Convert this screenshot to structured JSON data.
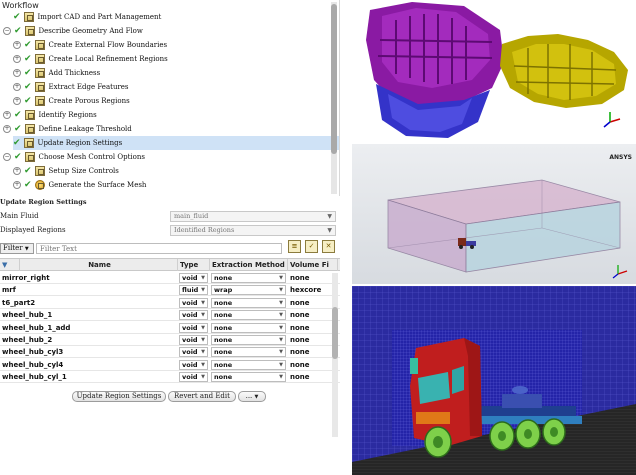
{
  "workflow": {
    "title": "Workflow",
    "items": [
      {
        "label": "Import CAD and Part Management",
        "expand": "",
        "icon": "import-cad-icon"
      },
      {
        "label": "Describe Geometry And Flow",
        "expand": "-",
        "icon": "geometry-icon"
      },
      {
        "label": "Create External Flow Boundaries",
        "expand": "+",
        "icon": "boundaries-icon"
      },
      {
        "label": "Create Local Refinement Regions",
        "expand": "+",
        "icon": "refinement-icon"
      },
      {
        "label": "Add Thickness",
        "expand": "+",
        "icon": "thickness-icon"
      },
      {
        "label": "Extract Edge Features",
        "expand": "+",
        "icon": "edge-features-icon"
      },
      {
        "label": "Create Porous Regions",
        "expand": "+",
        "icon": "porous-icon"
      },
      {
        "label": "Identify Regions",
        "expand": "+",
        "icon": "identify-icon"
      },
      {
        "label": "Define Leakage Threshold",
        "expand": "+",
        "icon": "leakage-icon"
      },
      {
        "label": "Update Region Settings",
        "expand": "",
        "icon": "region-settings-icon"
      },
      {
        "label": "Choose Mesh Control Options",
        "expand": "+",
        "icon": "mesh-control-icon"
      },
      {
        "label": "Setup Size Controls",
        "expand": "+",
        "icon": "size-controls-icon"
      },
      {
        "label": "Generate the Surface Mesh",
        "expand": "+",
        "icon": "surface-mesh-icon"
      }
    ]
  },
  "settings": {
    "title": "Update Region Settings",
    "main_fluid_label": "Main Fluid",
    "main_fluid_value": "main_fluid",
    "displayed_regions_label": "Displayed Regions",
    "displayed_regions_value": "Identified Regions",
    "filter_label": "Filter",
    "filter_placeholder": "Filter Text"
  },
  "table": {
    "columns": [
      "Name",
      "Type",
      "Extraction Method",
      "Volume Fi"
    ],
    "rows": [
      {
        "name": "mirror_right",
        "type": "void",
        "extraction": "none",
        "volume": "none"
      },
      {
        "name": "mrf",
        "type": "fluid",
        "extraction": "wrap",
        "volume": "hexcore"
      },
      {
        "name": "t6_part2",
        "type": "void",
        "extraction": "none",
        "volume": "none"
      },
      {
        "name": "wheel_hub_1",
        "type": "void",
        "extraction": "none",
        "volume": "none"
      },
      {
        "name": "wheel_hub_1_add",
        "type": "void",
        "extraction": "none",
        "volume": "none"
      },
      {
        "name": "wheel_hub_2",
        "type": "void",
        "extraction": "none",
        "volume": "none"
      },
      {
        "name": "wheel_hub_cyl3",
        "type": "void",
        "extraction": "none",
        "volume": "none"
      },
      {
        "name": "wheel_hub_cyl4",
        "type": "void",
        "extraction": "none",
        "volume": "none"
      },
      {
        "name": "wheel_hub_cyl_1",
        "type": "void",
        "extraction": "none",
        "volume": "none"
      }
    ]
  },
  "buttons": {
    "update": "Update Region Settings",
    "revert": "Revert and Edit",
    "more": "..."
  },
  "views": {
    "ansys_logo": "ANSYS"
  }
}
